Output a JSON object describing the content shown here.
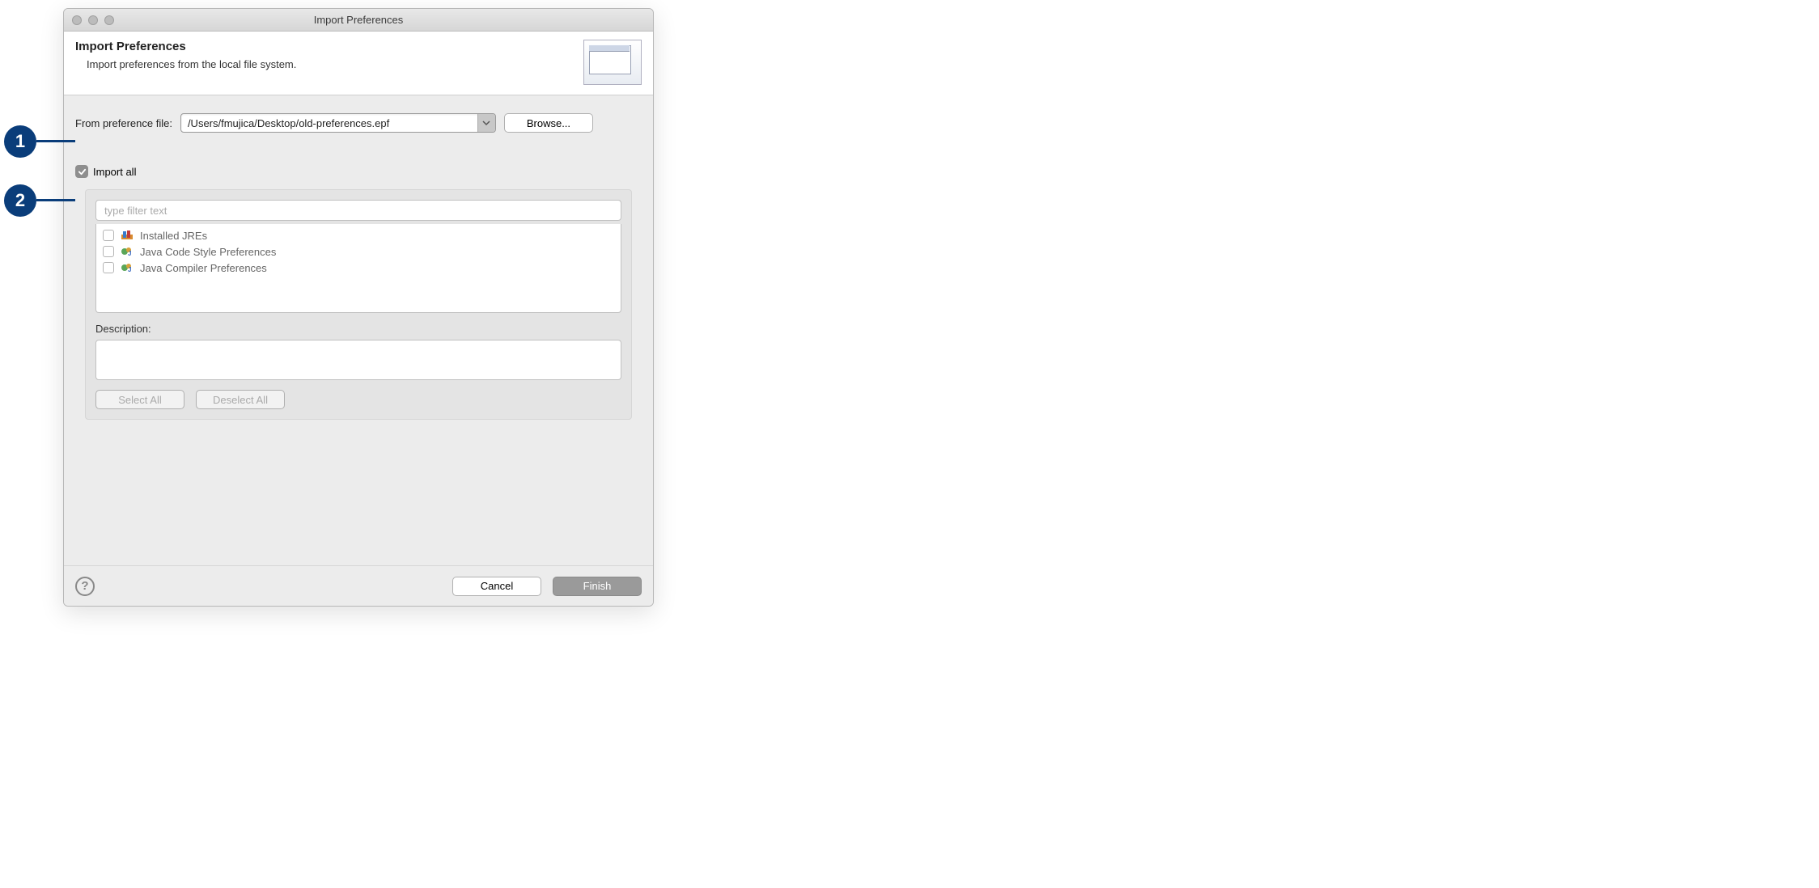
{
  "annotations": {
    "badge1": "1",
    "badge2": "2"
  },
  "titlebar": {
    "title": "Import Preferences"
  },
  "header": {
    "title": "Import Preferences",
    "subtitle": "Import preferences from the local file system."
  },
  "form": {
    "file_label": "From preference file:",
    "file_value": "/Users/fmujica/Desktop/old-preferences.epf",
    "browse_label": "Browse...",
    "import_all_label": "Import all",
    "filter_placeholder": "type filter text",
    "items": [
      {
        "label": "Installed JREs"
      },
      {
        "label": "Java Code Style Preferences"
      },
      {
        "label": "Java Compiler Preferences"
      }
    ],
    "description_label": "Description:",
    "select_all_label": "Select All",
    "deselect_all_label": "Deselect All"
  },
  "footer": {
    "help": "?",
    "cancel": "Cancel",
    "finish": "Finish"
  }
}
